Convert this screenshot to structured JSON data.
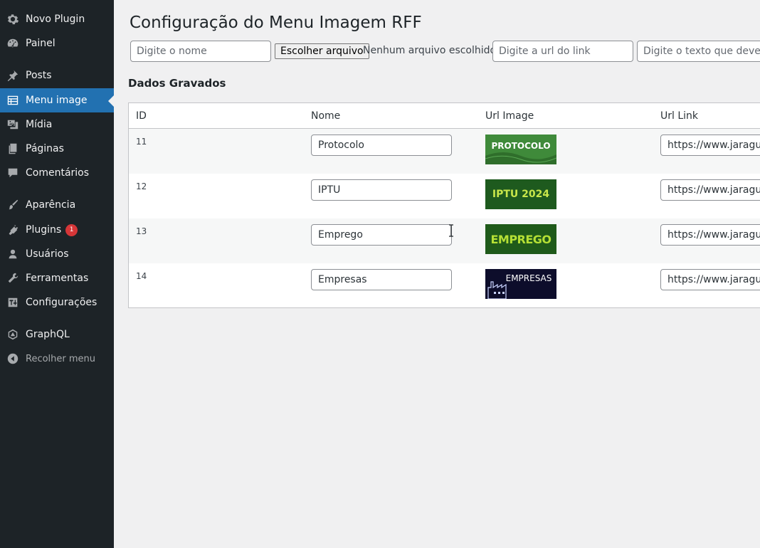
{
  "sidebar": {
    "items": [
      {
        "label": "Novo Plugin",
        "icon": "gear-icon"
      },
      {
        "label": "Painel",
        "icon": "dashboard-icon"
      },
      {
        "label": "Posts",
        "icon": "pin-icon"
      },
      {
        "label": "Menu image",
        "icon": "table-icon",
        "active": true
      },
      {
        "label": "Mídia",
        "icon": "media-icon"
      },
      {
        "label": "Páginas",
        "icon": "pages-icon"
      },
      {
        "label": "Comentários",
        "icon": "comment-icon"
      },
      {
        "label": "Aparência",
        "icon": "brush-icon"
      },
      {
        "label": "Plugins",
        "icon": "plugin-icon",
        "badge": "1"
      },
      {
        "label": "Usuários",
        "icon": "user-icon"
      },
      {
        "label": "Ferramentas",
        "icon": "wrench-icon"
      },
      {
        "label": "Configurações",
        "icon": "settings-sliders-icon"
      },
      {
        "label": "GraphQL",
        "icon": "graphql-icon"
      },
      {
        "label": "Recolher menu",
        "icon": "collapse-icon"
      }
    ]
  },
  "page": {
    "title": "Configuração do Menu Imagem RFF"
  },
  "form": {
    "name_placeholder": "Digite o nome",
    "file_button": "Escolher arquivo",
    "file_status": "Nenhum arquivo escolhido",
    "url_placeholder": "Digite a url do link",
    "text_placeholder": "Digite o texto que deve aparecer"
  },
  "saved": {
    "title": "Dados Gravados",
    "columns": [
      "ID",
      "Nome",
      "Url Image",
      "Url Link"
    ],
    "rows": [
      {
        "id": "11",
        "name": "Protocolo",
        "image_label": "PROTOCOLO",
        "url": "https://www.jaraguadosul.sc.gov.br",
        "thumb_bg": "#3f8a3a",
        "thumb_fg": "#ffffff"
      },
      {
        "id": "12",
        "name": "IPTU",
        "image_label": "IPTU 2024",
        "url": "https://www.jaraguadosul.sc.gov.br",
        "thumb_bg": "#1e5a1e",
        "thumb_fg": "#c8e64a"
      },
      {
        "id": "13",
        "name": "Emprego",
        "image_label": "EMPREGO",
        "url": "https://www.jaraguadosul.sc.gov.br",
        "thumb_bg": "#1f5a1a",
        "thumb_fg": "#b5e035"
      },
      {
        "id": "14",
        "name": "Empresas",
        "image_label": "EMPRESAS",
        "url": "https://www.jaraguadosul.sc.gov.br",
        "thumb_bg": "#0d0d2b",
        "thumb_fg": "#ffffff"
      }
    ]
  }
}
